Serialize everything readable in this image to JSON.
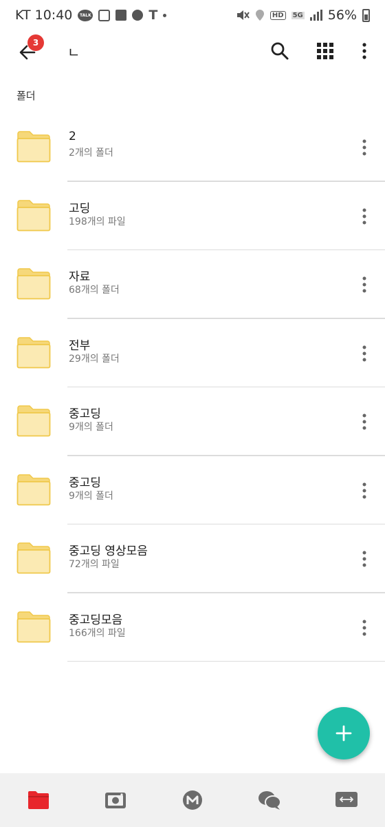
{
  "status_bar": {
    "carrier_time": "KT 10:40",
    "talk_label": "TALK",
    "hd_label": "HD",
    "network_label": "5G",
    "battery": "56%"
  },
  "app_bar": {
    "back_badge": "3",
    "title": "ㄴ",
    "icons": [
      "back-arrow-icon",
      "search-icon",
      "grid-view-icon",
      "more-vert-icon"
    ]
  },
  "section": {
    "label": "폴더"
  },
  "folders": [
    {
      "name": "2",
      "meta": "2개의 폴더"
    },
    {
      "name": "고딩",
      "meta": "198개의 파일"
    },
    {
      "name": "자료",
      "meta": "68개의 폴더"
    },
    {
      "name": "전부",
      "meta": "29개의 폴더"
    },
    {
      "name": "중고딩",
      "meta": "9개의 폴더"
    },
    {
      "name": "중고딩",
      "meta": "9개의 폴더"
    },
    {
      "name": "중고딩 영상모음",
      "meta": "72개의 파일"
    },
    {
      "name": "중고딩모음",
      "meta": "166개의 파일"
    }
  ],
  "fab": {
    "icon": "plus-icon"
  },
  "bottom_nav": {
    "items": [
      "folder-icon",
      "camera-icon",
      "m-icon",
      "chat-icon",
      "transfer-icon"
    ],
    "active": "folder-icon"
  },
  "colors": {
    "accent": "#20c0a8",
    "badge": "#e53935",
    "active_nav": "#e8262c",
    "folder_fill": "#fbeab3",
    "folder_stroke": "#f0c84a"
  }
}
